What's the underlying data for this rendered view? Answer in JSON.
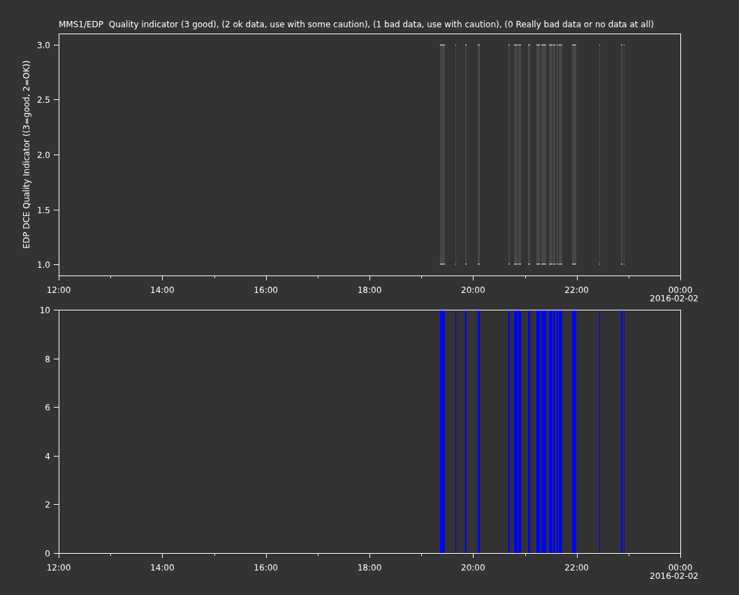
{
  "panels": [
    {
      "title": "MMS1/EDP  Quality indicator (3 good), (2 ok data, use with some caution), (1 bad data, use with caution), (0 Really bad data or no data at all)",
      "date_label": "2016-02-02",
      "chart_data": {
        "type": "area",
        "ylabel": "EDP DCE Quality Indicator ((3=good, 2=OK))",
        "xlim": [
          12,
          24
        ],
        "ylim": [
          0.9,
          3.1
        ],
        "xticks": [
          {
            "value": 12,
            "label": "12:00"
          },
          {
            "value": 14,
            "label": "14:00"
          },
          {
            "value": 16,
            "label": "16:00"
          },
          {
            "value": 18,
            "label": "18:00"
          },
          {
            "value": 20,
            "label": "20:00"
          },
          {
            "value": 22,
            "label": "22:00"
          },
          {
            "value": 24,
            "label": "00:00"
          }
        ],
        "yticks": [
          {
            "value": 1,
            "label": "1.0"
          },
          {
            "value": 1.5,
            "label": "1.5"
          },
          {
            "value": 2,
            "label": "2.0"
          },
          {
            "value": 2.5,
            "label": "2.5"
          },
          {
            "value": 3,
            "label": "3.0"
          }
        ],
        "x": [
          19.362,
          19.456,
          19.658,
          19.672,
          19.847,
          19.874,
          20.09,
          20.13,
          20.683,
          20.71,
          20.791,
          20.858,
          20.872,
          20.926,
          21.061,
          21.101,
          21.222,
          21.29,
          21.317,
          21.411,
          21.465,
          21.533,
          21.546,
          21.587,
          21.613,
          21.64,
          21.654,
          21.721,
          21.91,
          21.991,
          22.436,
          22.449,
          22.854,
          22.881,
          22.908,
          22.921
        ],
        "series": [
          {
            "color": "#474747",
            "values": [
              3,
              3,
              3,
              3,
              3,
              3,
              3,
              3,
              3,
              3,
              3,
              3,
              3,
              3,
              3,
              3,
              3,
              3,
              3,
              3,
              3,
              3,
              3,
              3,
              3,
              3,
              3,
              3,
              3,
              3,
              3,
              3,
              3,
              3,
              3,
              3
            ]
          }
        ]
      }
    },
    {
      "date_label": "2016-02-02",
      "chart_data": {
        "type": "area",
        "xlim": [
          12,
          24
        ],
        "ylim": [
          0,
          10
        ],
        "xticks": [
          {
            "value": 12,
            "label": "12:00"
          },
          {
            "value": 14,
            "label": "14:00"
          },
          {
            "value": 16,
            "label": "16:00"
          },
          {
            "value": 18,
            "label": "18:00"
          },
          {
            "value": 20,
            "label": "20:00"
          },
          {
            "value": 22,
            "label": "22:00"
          },
          {
            "value": 24,
            "label": "00:00"
          }
        ],
        "yticks": [
          {
            "value": 0,
            "label": "0"
          },
          {
            "value": 2,
            "label": "2"
          },
          {
            "value": 4,
            "label": "4"
          },
          {
            "value": 6,
            "label": "6"
          },
          {
            "value": 8,
            "label": "8"
          },
          {
            "value": 10,
            "label": "10"
          }
        ],
        "x": [
          19.362,
          19.456,
          19.658,
          19.672,
          19.847,
          19.874,
          20.09,
          20.13,
          20.683,
          20.71,
          20.791,
          20.858,
          20.872,
          20.926,
          21.061,
          21.101,
          21.222,
          21.29,
          21.317,
          21.411,
          21.465,
          21.533,
          21.546,
          21.587,
          21.613,
          21.64,
          21.654,
          21.721,
          21.91,
          21.991,
          22.436,
          22.449,
          22.854,
          22.881,
          22.908,
          22.921
        ],
        "series": [
          {
            "color": "#0000ff",
            "values": [
              10,
              10,
              10,
              10,
              10,
              10,
              10,
              10,
              10,
              10,
              10,
              10,
              10,
              10,
              10,
              10,
              10,
              10,
              10,
              10,
              10,
              10,
              10,
              10,
              10,
              10,
              10,
              10,
              10,
              10,
              10,
              10,
              10,
              10,
              10,
              10
            ]
          }
        ]
      }
    }
  ]
}
